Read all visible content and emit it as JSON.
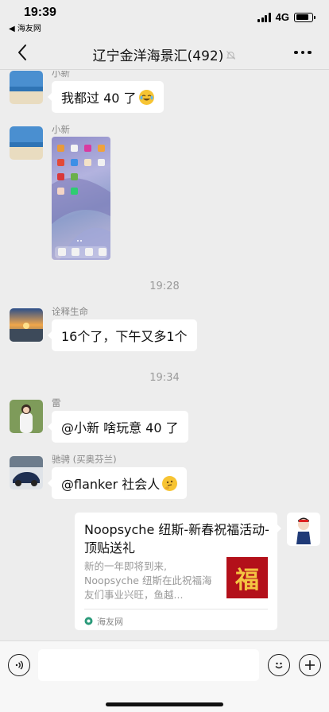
{
  "status_bar": {
    "time": "19:39",
    "back_app": "◀ 海友网",
    "network": "4G",
    "battery_level": 0.8
  },
  "nav": {
    "title": "辽宁金洋海景汇(492)",
    "muted_icon": "bell-off-icon",
    "more_icon": "more-dots-icon",
    "back_icon": "chevron-left-icon"
  },
  "messages": [
    {
      "sender": "小新",
      "text": "我都过 40 了",
      "emoji": "laughing-tears-emoji"
    },
    {
      "sender": "小新",
      "type": "image",
      "image": "phone-home-screen-screenshot"
    },
    {
      "timestamp": "19:28"
    },
    {
      "sender": "诠释生命",
      "text": "16个了，下午又多1个"
    },
    {
      "timestamp": "19:34"
    },
    {
      "sender": "雷",
      "text": "@小新 啥玩意 40 了"
    },
    {
      "sender": "驰骋 (买奥芬兰)",
      "text": "@flanker 社会人",
      "emoji": "thinking-emoji"
    },
    {
      "type": "link_card",
      "title": "Noopsyche 纽斯-新春祝福活动-顶贴送礼",
      "description": "新的一年即将到来, Noopsyche 纽斯在此祝福海友们事业兴旺，鱼越...",
      "thumbnail_text": "福",
      "source": "海友网"
    }
  ],
  "input_bar": {
    "placeholder": "",
    "voice_icon": "voice-icon",
    "emoji_icon": "emoji-icon",
    "plus_icon": "plus-icon"
  },
  "colors": {
    "background": "#ededed",
    "bubble": "#ffffff",
    "thumb_red": "#b3101a"
  }
}
